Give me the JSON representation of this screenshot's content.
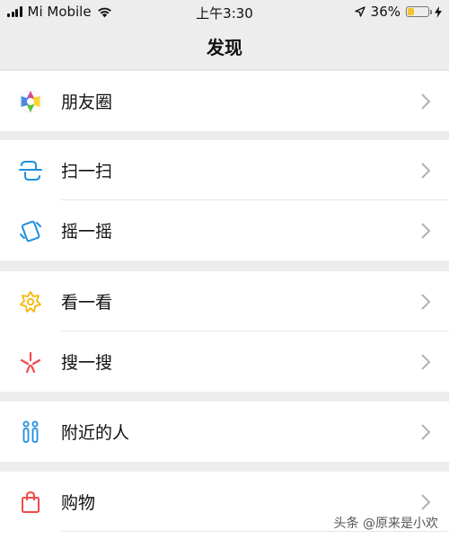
{
  "status_bar": {
    "carrier": "Mi Mobile",
    "time": "上午3:30",
    "battery_percent": "36%",
    "battery_level": 0.36,
    "battery_color": "#f3c52a",
    "icons": [
      "signal-icon",
      "wifi-icon",
      "location-arrow-icon",
      "battery-icon",
      "charging-bolt-icon"
    ]
  },
  "nav": {
    "title": "发现"
  },
  "menu": {
    "moments": {
      "label": "朋友圈",
      "icon": "moments-aperture-icon"
    },
    "scan": {
      "label": "扫一扫",
      "icon": "scan-icon",
      "color": "#1e8fe0"
    },
    "shake": {
      "label": "摇一摇",
      "icon": "shake-phone-icon",
      "color": "#1e8fe0"
    },
    "top_stories": {
      "label": "看一看",
      "icon": "top-stories-icon",
      "color": "#f5b800"
    },
    "search": {
      "label": "搜一搜",
      "icon": "search-spark-icon",
      "color": "#f04a4a"
    },
    "nearby": {
      "label": "附近的人",
      "icon": "people-nearby-icon",
      "color": "#1e8fe0"
    },
    "shopping": {
      "label": "购物",
      "icon": "shopping-bag-icon",
      "color": "#f04a4a"
    }
  },
  "watermark": {
    "text": "头条 @原来是小欢"
  }
}
